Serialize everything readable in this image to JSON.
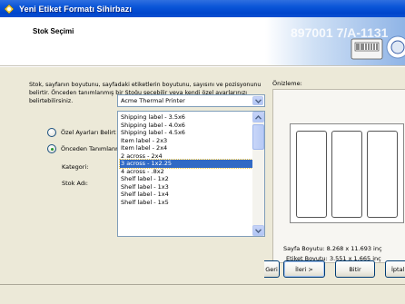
{
  "window": {
    "title": "Yeni Etiket Formatı Sihirbazı"
  },
  "header": {
    "page_title": "Stok Seçimi",
    "banner_text": "897001 7/A-1131"
  },
  "description": "Stok, sayfanın boyutunu, sayfadaki etiketlerin boyutunu, sayısını ve pozisyonunu belirtir. Önceden tanımlanmış bir Stoğu seçebilir veya kendi özel ayarlarınızı belirtebilirsiniz.",
  "options": {
    "custom": "Özel Ayarları Belirt",
    "predefined": "Önceden Tanımlanmış Stok Kullan",
    "selected": "predefined"
  },
  "category": {
    "label": "Kategori:",
    "value": "Acme Thermal Printer"
  },
  "stock": {
    "label": "Stok Adı:",
    "items": [
      "Shipping label - 3.5x6",
      "Shipping label - 4.0x6",
      "Shipping label - 4.5x6",
      "Item label - 2x3",
      "Item label - 2x4",
      "2 across - 2x4",
      "3 across - 1x2.25",
      "4 across - .8x2",
      "Shelf label - 1x2",
      "Shelf label - 1x3",
      "Shelf label - 1x4",
      "Shelf label - 1x5"
    ],
    "selected_index": 6
  },
  "preview": {
    "label": "Önizleme:",
    "page_size_label": "Sayfa Boyutu:",
    "page_size_value": "8.268 x 11.693 inç",
    "label_size_label": "Etiket Boyutu:",
    "label_size_value": "3.551 x 1.665 inç",
    "columns": 3
  },
  "buttons": {
    "back": "Geri",
    "next": "İleri >",
    "finish": "Bitir",
    "cancel": "İptal"
  },
  "colors": {
    "title_bar": "#0a55d8",
    "dialog_bg": "#ece9d8",
    "selection": "#316ac5"
  }
}
